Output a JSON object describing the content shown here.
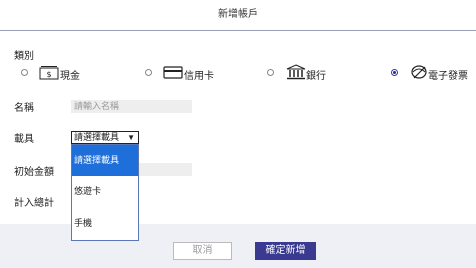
{
  "header": {
    "title": "新增帳戶"
  },
  "form": {
    "category_label": "類別",
    "category_options": [
      {
        "label": "現金",
        "icon": "cash-icon",
        "checked": false
      },
      {
        "label": "信用卡",
        "icon": "credit-card-icon",
        "checked": false
      },
      {
        "label": "銀行",
        "icon": "bank-icon",
        "checked": false
      },
      {
        "label": "電子發票",
        "icon": "e-invoice-icon",
        "checked": true
      }
    ],
    "name_label": "名稱",
    "name_placeholder": "請輸入名稱",
    "carrier_label": "載具",
    "carrier_select_value": "請選擇載具",
    "carrier_options": [
      "請選擇載具",
      "悠遊卡",
      "手機"
    ],
    "initial_amount_label": "初始金額",
    "include_total_label": "計入總計"
  },
  "footer": {
    "cancel_label": "取消",
    "confirm_label": "確定新增"
  },
  "colors": {
    "primary": "#3a3a90",
    "dropdown_highlight": "#1e6fd9"
  }
}
